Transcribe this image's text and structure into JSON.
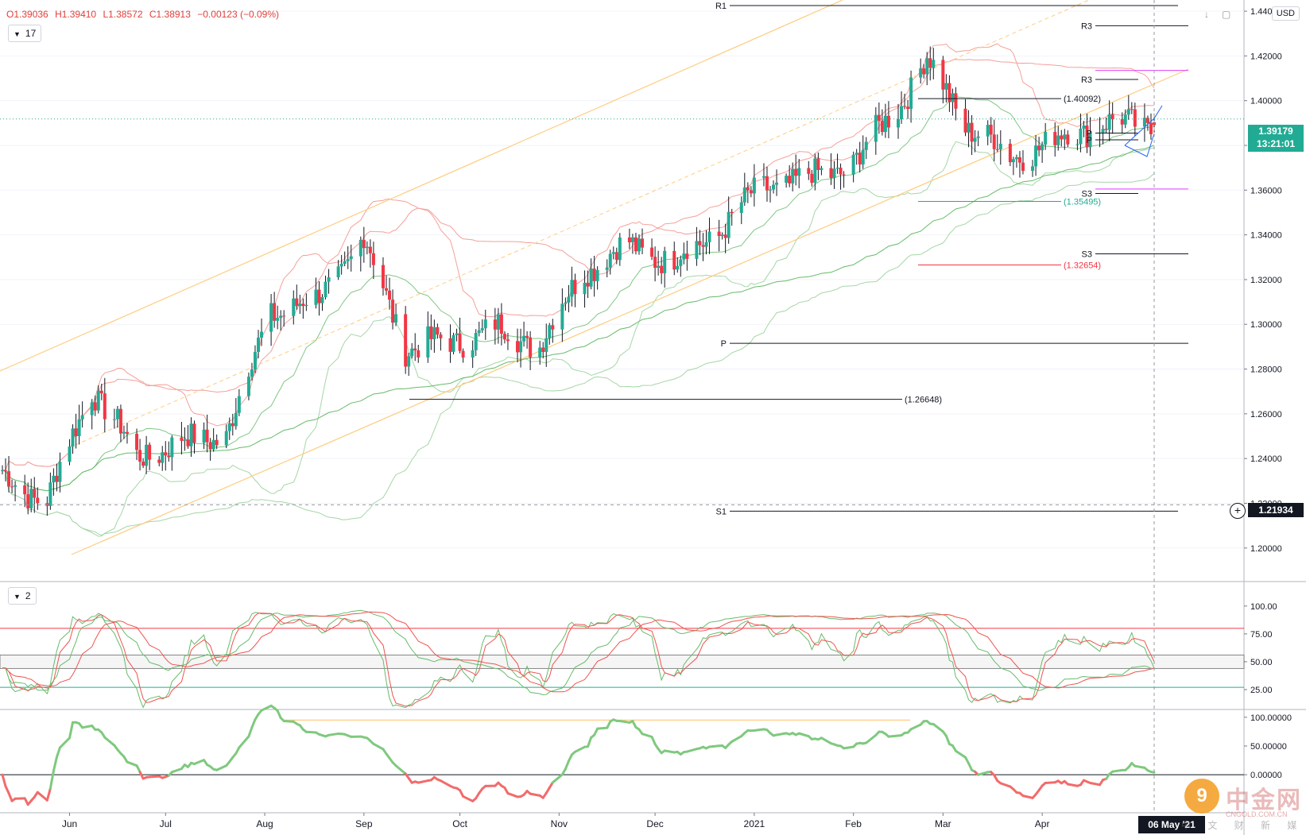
{
  "legend": {
    "open": "O1.39036",
    "high": "H1.39410",
    "low": "L1.38572",
    "close": "C1.38913",
    "change": "−0.00123 (−0.09%)"
  },
  "currency": "USD",
  "pane_buttons": {
    "main": "17",
    "stoch": "2"
  },
  "last_price": {
    "value": "1.39179",
    "countdown": "13:21:01"
  },
  "crosshair_price": "1.21934",
  "crosshair_date": "06 May '21",
  "watermark": {
    "logo": "9",
    "name": "中金网",
    "url": "CNGOLD.COM.CN",
    "subtitle": "中 文 财 新 媒 体"
  },
  "colors": {
    "up": "#22ab94",
    "down": "#f23645",
    "bg": "#ffffff",
    "grid": "#eef0f3"
  },
  "chart_data": {
    "type": "candlestick",
    "instrument_currency": "USD",
    "y_axis": {
      "min": 1.185,
      "max": 1.445,
      "ticks": [
        1.2,
        1.22,
        1.24,
        1.26,
        1.28,
        1.3,
        1.32,
        1.34,
        1.36,
        1.38,
        1.4,
        1.42,
        1.44
      ],
      "tick_labels": [
        "1.20000",
        "1.22000",
        "1.24000",
        "1.26000",
        "1.28000",
        "1.30000",
        "1.32000",
        "1.34000",
        "1.36000",
        "1.38000",
        "1.40000",
        "1.42000",
        "1.44000"
      ]
    },
    "x_axis": {
      "labels": [
        "Jun",
        "Jul",
        "Aug",
        "Sep",
        "Oct",
        "Nov",
        "Dec",
        "2021",
        "Feb",
        "Mar",
        "Apr"
      ],
      "start_date": "2020-05-11",
      "end_date": "2021-05-06"
    },
    "candles_sampled": [
      {
        "date": "2020-05-11",
        "close": 1.232
      },
      {
        "date": "2020-05-25",
        "close": 1.221
      },
      {
        "date": "2020-06-08",
        "close": 1.272
      },
      {
        "date": "2020-06-22",
        "close": 1.241
      },
      {
        "date": "2020-07-06",
        "close": 1.247
      },
      {
        "date": "2020-07-20",
        "close": 1.251
      },
      {
        "date": "2020-08-03",
        "close": 1.306
      },
      {
        "date": "2020-08-17",
        "close": 1.31
      },
      {
        "date": "2020-09-01",
        "close": 1.338
      },
      {
        "date": "2020-09-14",
        "close": 1.29
      },
      {
        "date": "2020-09-28",
        "close": 1.292
      },
      {
        "date": "2020-10-12",
        "close": 1.298
      },
      {
        "date": "2020-10-26",
        "close": 1.291
      },
      {
        "date": "2020-11-09",
        "close": 1.325
      },
      {
        "date": "2020-11-23",
        "close": 1.335
      },
      {
        "date": "2020-12-07",
        "close": 1.328
      },
      {
        "date": "2020-12-21",
        "close": 1.342
      },
      {
        "date": "2021-01-04",
        "close": 1.362
      },
      {
        "date": "2021-01-18",
        "close": 1.365
      },
      {
        "date": "2021-02-01",
        "close": 1.372
      },
      {
        "date": "2021-02-15",
        "close": 1.398
      },
      {
        "date": "2021-02-24",
        "close": 1.418
      },
      {
        "date": "2021-03-08",
        "close": 1.39
      },
      {
        "date": "2021-03-22",
        "close": 1.375
      },
      {
        "date": "2021-04-05",
        "close": 1.382
      },
      {
        "date": "2021-04-19",
        "close": 1.39
      },
      {
        "date": "2021-05-06",
        "close": 1.389
      }
    ],
    "level_lines": [
      {
        "label": "R1",
        "value": 1.4425,
        "color": "#131722"
      },
      {
        "label": "R3",
        "value": 1.4335,
        "color": "#131722"
      },
      {
        "label": "R3",
        "value": 1.4095,
        "color": "#131722"
      },
      {
        "label": "",
        "value": 1.4135,
        "color": "#e040fb"
      },
      {
        "label": "(1.40092)",
        "value": 1.40092,
        "color": "#131722"
      },
      {
        "label": "P",
        "value": 1.3855,
        "color": "#131722"
      },
      {
        "label": "P",
        "value": 1.3825,
        "color": "#131722"
      },
      {
        "label": "S3",
        "value": 1.3585,
        "color": "#131722"
      },
      {
        "label": "",
        "value": 1.3605,
        "color": "#e040fb"
      },
      {
        "label": "(1.35495)",
        "value": 1.35495,
        "color": "#22ab94"
      },
      {
        "label": "S3",
        "value": 1.3315,
        "color": "#131722"
      },
      {
        "label": "(1.32654)",
        "value": 1.32654,
        "color": "#f23645"
      },
      {
        "label": "P",
        "value": 1.2915,
        "color": "#131722"
      },
      {
        "label": "(1.26648)",
        "value": 1.26648,
        "color": "#131722"
      },
      {
        "label": "S1",
        "value": 1.2165,
        "color": "#131722"
      }
    ],
    "stochastic": {
      "y_ticks": [
        25,
        50,
        75,
        100
      ],
      "tick_labels": [
        "25.00",
        "50.00",
        "75.00",
        "100.00"
      ],
      "upper_level": 80,
      "lower_level": 27
    },
    "oscillator": {
      "y_ticks": [
        0,
        50,
        100
      ],
      "tick_labels": [
        "0.00000",
        "50.00000",
        "100.00000"
      ]
    }
  }
}
